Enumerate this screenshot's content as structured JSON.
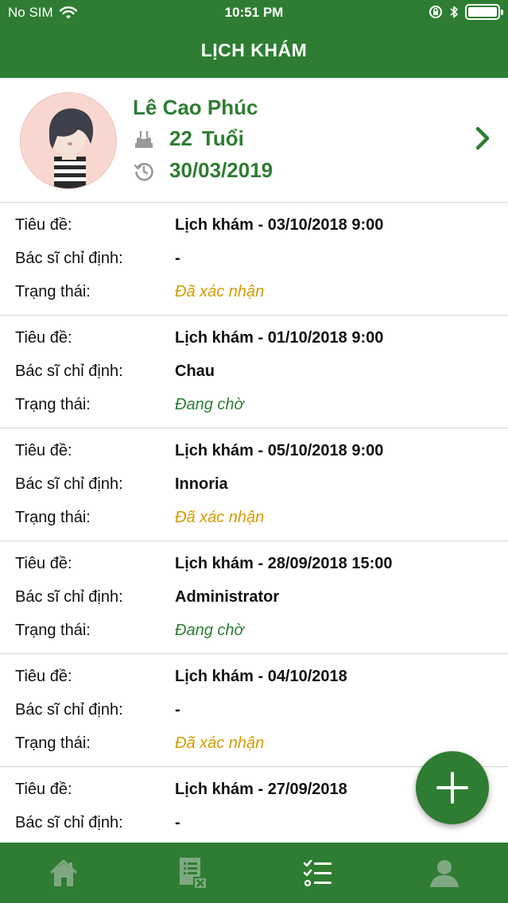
{
  "status_bar": {
    "carrier": "No SIM",
    "time": "10:51 PM"
  },
  "nav": {
    "title": "LỊCH KHÁM"
  },
  "profile": {
    "name": "Lê Cao Phúc",
    "age_number": "22",
    "age_unit": "Tuổi",
    "date": "30/03/2019"
  },
  "labels": {
    "title": "Tiêu đề:",
    "doctor": "Bác sĩ chỉ định:",
    "status": "Trạng thái:"
  },
  "appointments": [
    {
      "title": "Lịch khám - 03/10/2018 9:00",
      "doctor": "-",
      "status": "Đã xác nhận"
    },
    {
      "title": "Lịch khám - 01/10/2018 9:00",
      "doctor": "Chau",
      "status": "Đang chờ"
    },
    {
      "title": "Lịch khám - 05/10/2018 9:00",
      "doctor": "Innoria",
      "status": "Đã xác nhận"
    },
    {
      "title": "Lịch khám - 28/09/2018 15:00",
      "doctor": "Administrator",
      "status": "Đang chờ"
    },
    {
      "title": "Lịch khám - 04/10/2018",
      "doctor": "-",
      "status": "Đã xác nhận"
    },
    {
      "title": "Lịch khám - 27/09/2018",
      "doctor": "-",
      "status": ""
    }
  ],
  "colors": {
    "primary": "#2e7d32",
    "confirmed": "#d49b00",
    "pending": "#2e7d32",
    "tab_inactive": "#7fa882"
  },
  "tabs": [
    {
      "icon": "home-icon",
      "active": false
    },
    {
      "icon": "medical-record-icon",
      "active": false
    },
    {
      "icon": "checklist-icon",
      "active": true
    },
    {
      "icon": "user-icon",
      "active": false
    }
  ]
}
